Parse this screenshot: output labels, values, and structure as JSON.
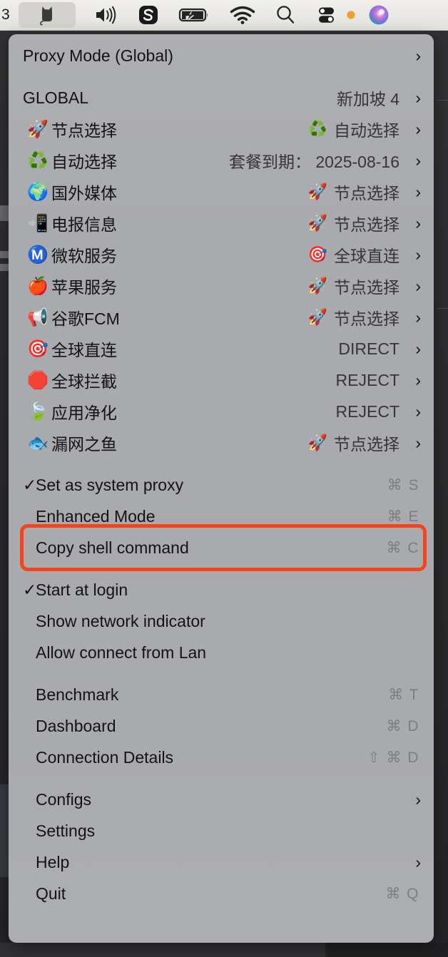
{
  "menubar": {
    "clock": "3",
    "icons": [
      {
        "name": "clashx-cat-icon",
        "label": "ClashX"
      },
      {
        "name": "volume-icon",
        "label": "Volume"
      },
      {
        "name": "app-s-icon",
        "label": "S App"
      },
      {
        "name": "battery-charging-icon",
        "label": "Battery Charging"
      },
      {
        "name": "wifi-icon",
        "label": "Wi-Fi"
      },
      {
        "name": "spotlight-search-icon",
        "label": "Spotlight Search"
      },
      {
        "name": "control-center-icon",
        "label": "Control Center"
      },
      {
        "name": "orange-dot-indicator",
        "label": "Recording indicator"
      },
      {
        "name": "siri-icon",
        "label": "Siri"
      }
    ]
  },
  "menu": {
    "proxy_mode": {
      "label": "Proxy Mode (Global)",
      "chevron": "›"
    },
    "global": {
      "label": "GLOBAL",
      "value": "新加坡 4",
      "chevron": "›"
    },
    "groups": [
      {
        "emoji": "🚀",
        "label": "节点选择",
        "value_emoji": "♻️",
        "value": "自动选择",
        "chevron": "›"
      },
      {
        "emoji": "♻️",
        "label": "自动选择",
        "value_emoji": "",
        "value": "套餐到期： 2025-08-16",
        "chevron": "›"
      },
      {
        "emoji": "🌍",
        "label": "国外媒体",
        "value_emoji": "🚀",
        "value": "节点选择",
        "chevron": "›"
      },
      {
        "emoji": "📲",
        "label": "电报信息",
        "value_emoji": "🚀",
        "value": "节点选择",
        "chevron": "›"
      },
      {
        "emoji": "Ⓜ️",
        "label": "微软服务",
        "value_emoji": "🎯",
        "value": "全球直连",
        "chevron": "›"
      },
      {
        "emoji": "🍎",
        "label": "苹果服务",
        "value_emoji": "🚀",
        "value": "节点选择",
        "chevron": "›"
      },
      {
        "emoji": "📢",
        "label": "谷歌FCM",
        "value_emoji": "🚀",
        "value": "节点选择",
        "chevron": "›"
      },
      {
        "emoji": "🎯",
        "label": "全球直连",
        "value_emoji": "",
        "value": "DIRECT",
        "chevron": "›"
      },
      {
        "emoji": "🛑",
        "label": "全球拦截",
        "value_emoji": "",
        "value": "REJECT",
        "chevron": "›"
      },
      {
        "emoji": "🍃",
        "label": "应用净化",
        "value_emoji": "",
        "value": "REJECT",
        "chevron": "›"
      },
      {
        "emoji": "🐟",
        "label": "漏网之鱼",
        "value_emoji": "🚀",
        "value": "节点选择",
        "chevron": "›"
      }
    ],
    "options_a": [
      {
        "check": "✓",
        "label": "Set as system proxy",
        "shortcut": "⌘ S",
        "highlighted": false
      },
      {
        "check": "",
        "label": "Enhanced Mode",
        "shortcut": "⌘ E",
        "highlighted": false
      },
      {
        "check": "",
        "label": "Copy shell command",
        "shortcut": "⌘ C",
        "highlighted": true
      }
    ],
    "options_b": [
      {
        "check": "✓",
        "label": "Start at login",
        "shortcut": ""
      },
      {
        "check": "",
        "label": "Show network indicator",
        "shortcut": ""
      },
      {
        "check": "",
        "label": "Allow connect from Lan",
        "shortcut": ""
      }
    ],
    "tools": [
      {
        "label": "Benchmark",
        "shortcut": "⌘ T"
      },
      {
        "label": "Dashboard",
        "shortcut": "⌘ D"
      },
      {
        "label": "Connection Details",
        "shortcut": "⇧ ⌘ D"
      }
    ],
    "footer": [
      {
        "label": "Configs",
        "shortcut": "",
        "chevron": "›"
      },
      {
        "label": "Settings",
        "shortcut": "",
        "chevron": ""
      },
      {
        "label": "Help",
        "shortcut": "",
        "chevron": "›"
      },
      {
        "label": "Quit",
        "shortcut": "⌘ Q",
        "chevron": ""
      }
    ],
    "highlight_color": "#f4441e"
  }
}
